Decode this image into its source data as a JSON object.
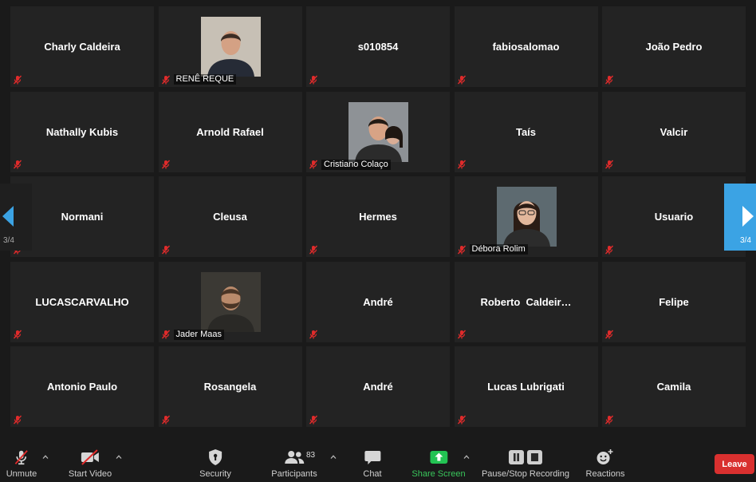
{
  "participants": [
    {
      "name": "Charly Caldeira",
      "has_photo": false,
      "muted": true
    },
    {
      "name": "RENÊ REQUE",
      "has_photo": true,
      "muted": true
    },
    {
      "name": "s010854",
      "has_photo": false,
      "muted": true
    },
    {
      "name": "fabiosalomao",
      "has_photo": false,
      "muted": true
    },
    {
      "name": "João Pedro",
      "has_photo": false,
      "muted": true
    },
    {
      "name": "Nathally Kubis",
      "has_photo": false,
      "muted": true
    },
    {
      "name": "Arnold Rafael",
      "has_photo": false,
      "muted": true
    },
    {
      "name": "Cristiano Colaço",
      "has_photo": true,
      "muted": true
    },
    {
      "name": "Taís",
      "has_photo": false,
      "muted": true
    },
    {
      "name": "Valcir",
      "has_photo": false,
      "muted": true
    },
    {
      "name": "Normani",
      "has_photo": false,
      "muted": true
    },
    {
      "name": "Cleusa",
      "has_photo": false,
      "muted": true
    },
    {
      "name": "Hermes",
      "has_photo": false,
      "muted": true
    },
    {
      "name": "Débora Rolim",
      "has_photo": true,
      "muted": true
    },
    {
      "name": "Usuario",
      "has_photo": false,
      "muted": true
    },
    {
      "name": "LUCASCARVALHO",
      "has_photo": false,
      "muted": true
    },
    {
      "name": "Jader Maas",
      "has_photo": true,
      "muted": true
    },
    {
      "name": "André",
      "has_photo": false,
      "muted": true
    },
    {
      "name": "Roberto  Caldeir…",
      "has_photo": false,
      "muted": true
    },
    {
      "name": "Felipe",
      "has_photo": false,
      "muted": true
    },
    {
      "name": "Antonio Paulo",
      "has_photo": false,
      "muted": true
    },
    {
      "name": "Rosangela",
      "has_photo": false,
      "muted": true
    },
    {
      "name": "André",
      "has_photo": false,
      "muted": true
    },
    {
      "name": "Lucas Lubrigati",
      "has_photo": false,
      "muted": true
    },
    {
      "name": "Camila",
      "has_photo": false,
      "muted": true
    }
  ],
  "pager": {
    "left": "3/4",
    "right": "3/4",
    "left_icon": "arrow-left-icon",
    "right_icon": "arrow-right-icon"
  },
  "toolbar": {
    "unmute": {
      "label": "Unmute",
      "icon": "mic-muted-icon"
    },
    "start_video": {
      "label": "Start Video",
      "icon": "video-off-icon"
    },
    "security": {
      "label": "Security",
      "icon": "shield-icon"
    },
    "participants": {
      "label": "Participants",
      "icon": "participants-icon",
      "count": "83"
    },
    "chat": {
      "label": "Chat",
      "icon": "chat-icon"
    },
    "share_screen": {
      "label": "Share Screen",
      "icon": "share-screen-icon"
    },
    "recording": {
      "label": "Pause/Stop Recording",
      "icon": "pause-stop-recording-icon"
    },
    "reactions": {
      "label": "Reactions",
      "icon": "reactions-icon"
    },
    "leave": {
      "label": "Leave"
    }
  },
  "colors": {
    "background": "#1a1a1a",
    "tile": "#232323",
    "muted_red": "#e02b2b",
    "share_green": "#23c353",
    "leave_red": "#d9302f",
    "pager_blue": "#3ba3e4"
  }
}
